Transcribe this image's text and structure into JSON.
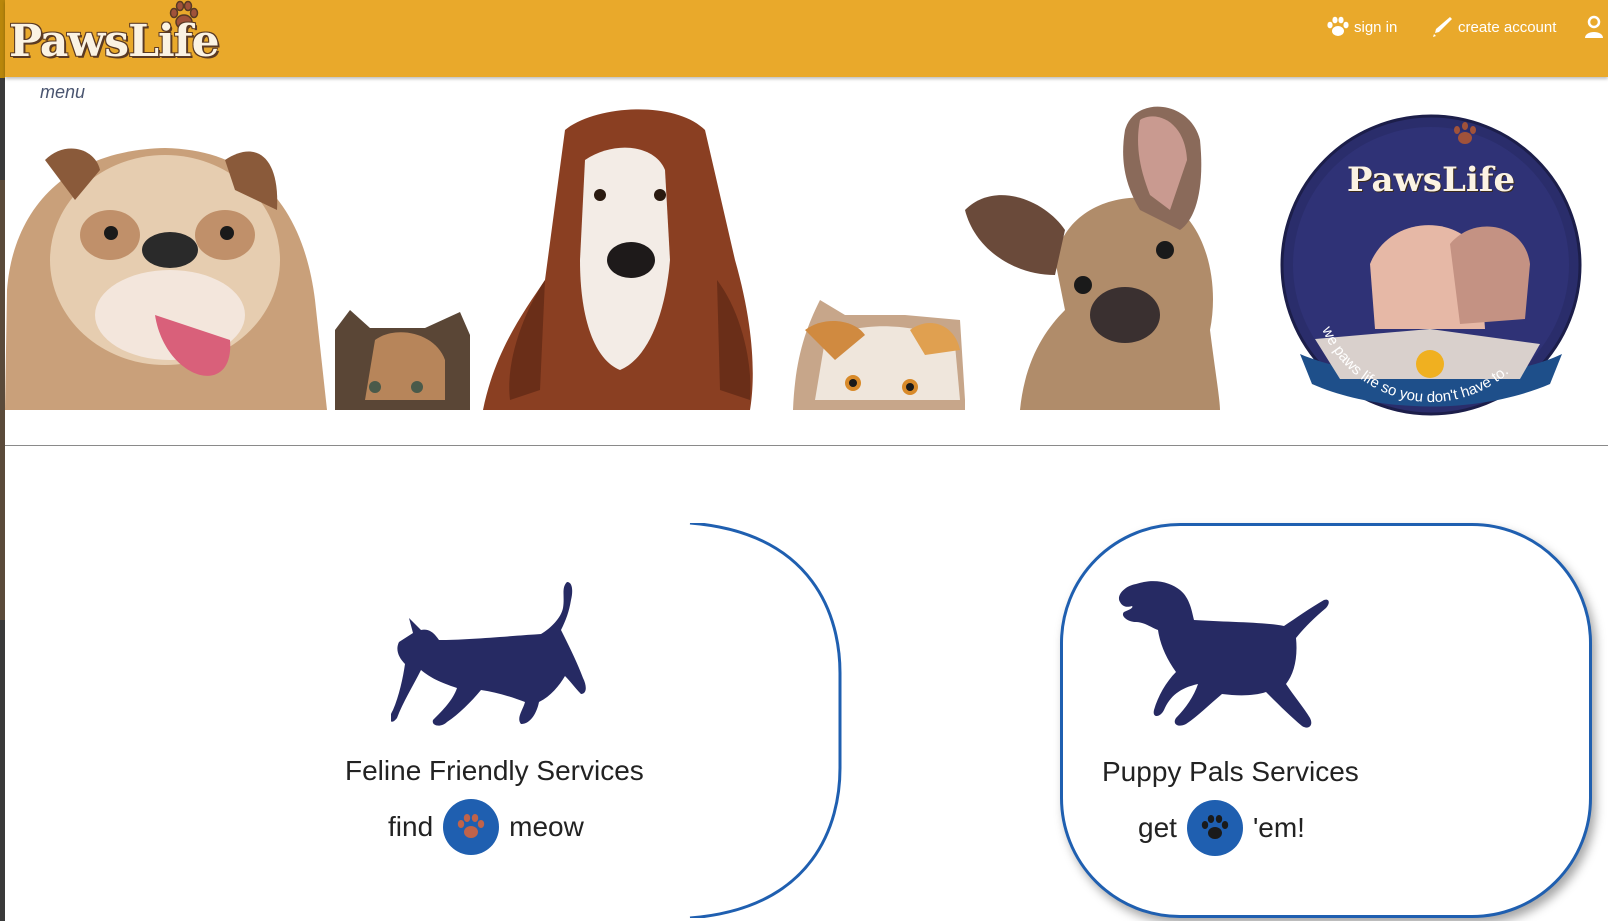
{
  "brand": {
    "name": "PawsLife"
  },
  "nav": {
    "sign_in": "sign in",
    "create_account": "create account"
  },
  "menu_label": "menu",
  "banner": {
    "seal_title": "PawsLife",
    "seal_tagline": "we paws life so you don't have to."
  },
  "services": [
    {
      "title": "Feline Friendly Services",
      "prefix": "find",
      "suffix": "meow",
      "paw_color": "#c0634a"
    },
    {
      "title": "Puppy Pals Services",
      "prefix": "get",
      "suffix": "'em!",
      "paw_color": "#1a1a1a"
    }
  ],
  "colors": {
    "header": "#e9a92b",
    "accent_blue": "#1f5fb0",
    "silhouette": "#262a63",
    "seal_bg": "#2a2d6b"
  }
}
